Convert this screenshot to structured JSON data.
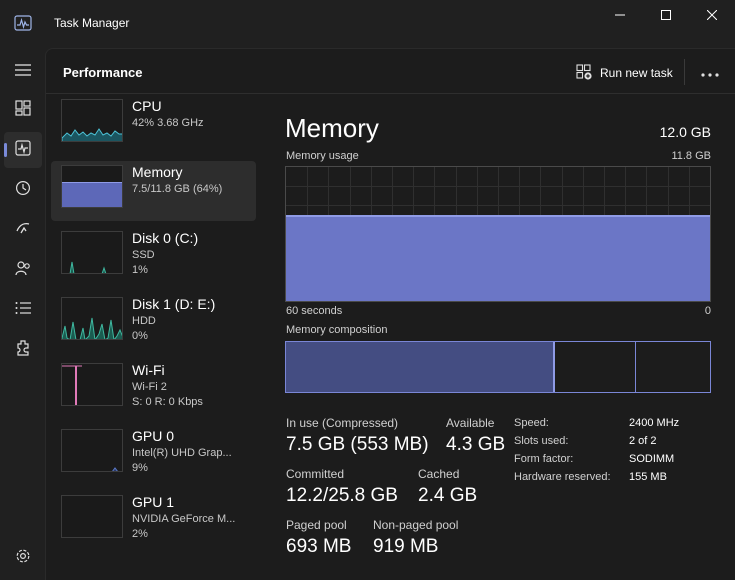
{
  "window": {
    "title": "Task Manager"
  },
  "nav": {
    "items": [
      {
        "icon": "hamburger-menu-icon"
      },
      {
        "icon": "processes-icon"
      },
      {
        "icon": "performance-icon"
      },
      {
        "icon": "app-history-icon"
      },
      {
        "icon": "startup-apps-icon"
      },
      {
        "icon": "users-icon"
      },
      {
        "icon": "details-icon"
      },
      {
        "icon": "services-icon"
      },
      {
        "icon": "settings-icon"
      }
    ]
  },
  "header": {
    "title": "Performance",
    "run_new_task": "Run new task"
  },
  "resources": [
    {
      "name": "CPU",
      "sub1": "42% 3.68 GHz",
      "sub2": "",
      "color": "#4cc2d6"
    },
    {
      "name": "Memory",
      "sub1": "7.5/11.8 GB (64%)",
      "sub2": "",
      "color": "#7a86d6"
    },
    {
      "name": "Disk 0 (C:)",
      "sub1": "SSD",
      "sub2": "1%",
      "color": "#3fb8a0"
    },
    {
      "name": "Disk 1 (D: E:)",
      "sub1": "HDD",
      "sub2": "0%",
      "color": "#3fb8a0"
    },
    {
      "name": "Wi-Fi",
      "sub1": "Wi-Fi 2",
      "sub2": "S: 0 R: 0 Kbps",
      "color": "#e07ab8"
    },
    {
      "name": "GPU 0",
      "sub1": "Intel(R) UHD Grap...",
      "sub2": "9%",
      "color": "#5a78c8"
    },
    {
      "name": "GPU 1",
      "sub1": "NVIDIA GeForce M...",
      "sub2": "2%",
      "color": "#5a78c8"
    }
  ],
  "detail": {
    "title": "Memory",
    "total": "12.0 GB",
    "usage_label": "Memory usage",
    "usage_max": "11.8 GB",
    "usage_fraction": 0.64,
    "time_span": "60 seconds",
    "time_end": "0",
    "composition_label": "Memory composition",
    "composition_fractions": [
      0.635,
      0.19,
      0.175
    ],
    "stats": {
      "in_use_label": "In use (Compressed)",
      "in_use_value": "7.5 GB (553 MB)",
      "available_label": "Available",
      "available_value": "4.3 GB",
      "committed_label": "Committed",
      "committed_value": "12.2/25.8 GB",
      "cached_label": "Cached",
      "cached_value": "2.4 GB",
      "paged_label": "Paged pool",
      "paged_value": "693 MB",
      "nonpaged_label": "Non-paged pool",
      "nonpaged_value": "919 MB"
    },
    "specs": {
      "speed_label": "Speed:",
      "speed_value": "2400 MHz",
      "slots_label": "Slots used:",
      "slots_value": "2 of 2",
      "form_label": "Form factor:",
      "form_value": "SODIMM",
      "reserved_label": "Hardware reserved:",
      "reserved_value": "155 MB"
    }
  },
  "colors": {
    "accent": "#7a86d6",
    "background": "#202020",
    "panel": "#1c1c1c"
  }
}
